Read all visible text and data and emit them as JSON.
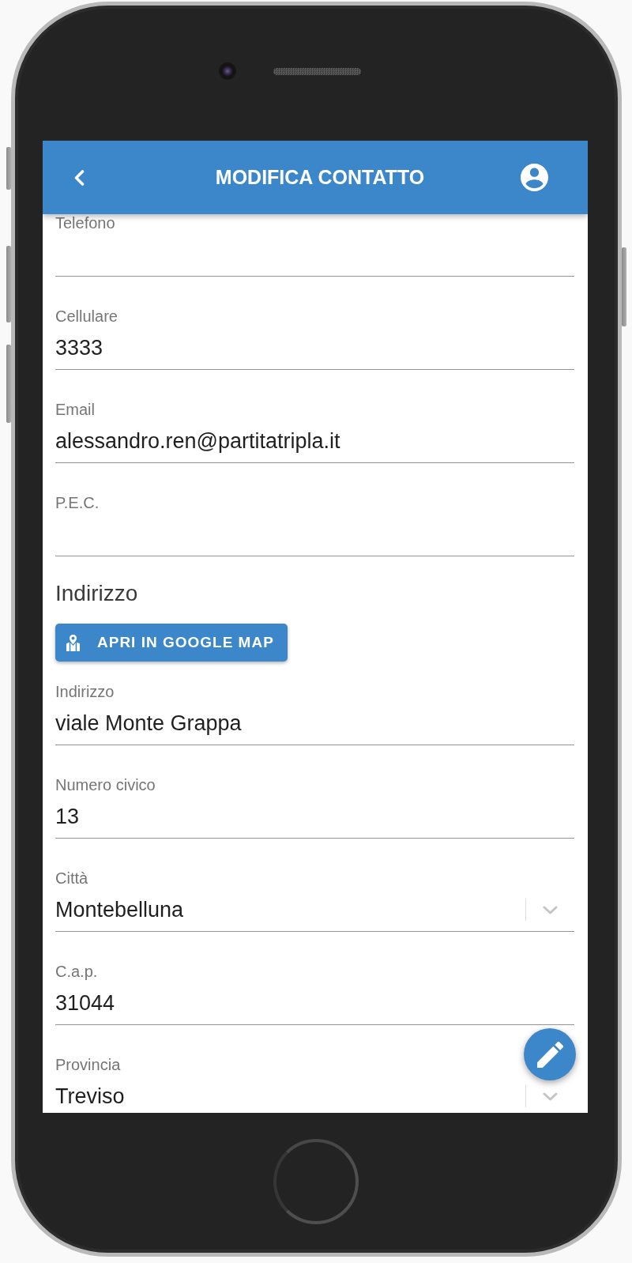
{
  "app_bar": {
    "title": "MODIFICA CONTATTO"
  },
  "contact_fields": [
    {
      "label": "Telefono",
      "kind": "text"
    },
    {
      "label": "Cellulare",
      "value": "3333",
      "kind": "text"
    },
    {
      "label": "Email",
      "value": "alessandro.ren@partitatripla.it",
      "kind": "text"
    },
    {
      "label": "P.E.C.",
      "kind": "text"
    }
  ],
  "address": {
    "heading": "Indirizzo",
    "map_button": "APRI IN GOOGLE MAP",
    "fields": [
      {
        "label": "Indirizzo",
        "value": "viale Monte Grappa",
        "kind": "text"
      },
      {
        "label": "Numero civico",
        "value": "13",
        "kind": "text"
      },
      {
        "label": "Città",
        "value": "Montebelluna",
        "kind": "select"
      },
      {
        "label": "C.a.p.",
        "value": "31044",
        "kind": "text"
      },
      {
        "label": "Provincia",
        "value": "Treviso",
        "kind": "select"
      }
    ]
  }
}
